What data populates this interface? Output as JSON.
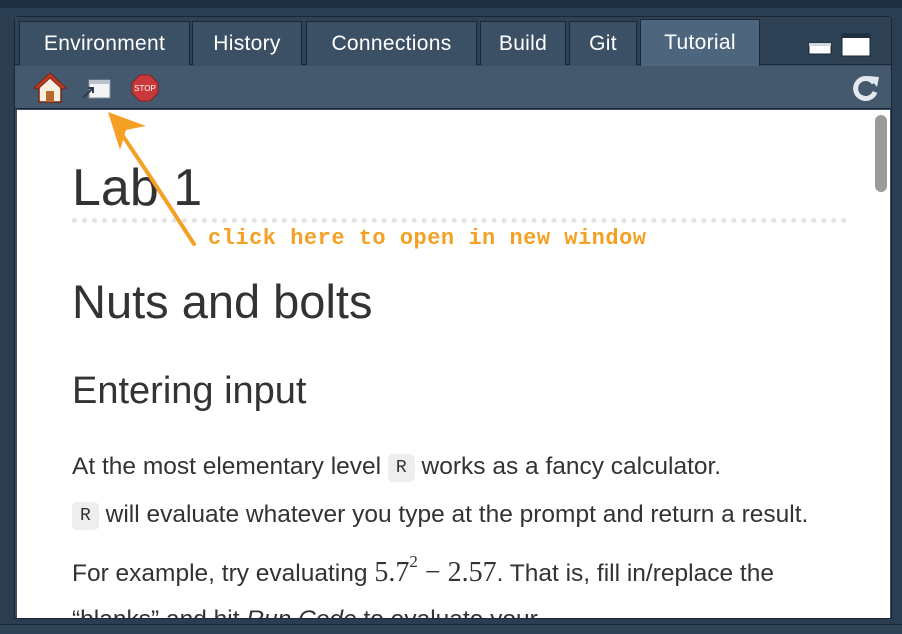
{
  "tabs": [
    {
      "label": "Environment",
      "active": false
    },
    {
      "label": "History",
      "active": false
    },
    {
      "label": "Connections",
      "active": false
    },
    {
      "label": "Build",
      "active": false
    },
    {
      "label": "Git",
      "active": false
    },
    {
      "label": "Tutorial",
      "active": true
    }
  ],
  "toolbar": {
    "home_icon": "home-icon",
    "popout_icon": "open-in-new-window-icon",
    "stop_icon": "stop-icon",
    "stop_label": "STOP",
    "refresh_icon": "refresh-icon"
  },
  "content": {
    "h1": "Lab 1",
    "h2": "Nuts and bolts",
    "h3": "Entering input",
    "p_1": "At the most elementary level ",
    "code_r": "R",
    "p_2": " works as a fancy calculator.",
    "p_3": " will evaluate whatever you type at the prompt and return a result. For example, try evaluating ",
    "math_base": "5.7",
    "math_exp": "2",
    "math_rest": " − 2.57",
    "p_4": ". That is, fill in/replace the “blanks” and hit ",
    "p_em": "Run Code",
    "p_5": " to evaluate your"
  },
  "annotation": {
    "text": "click here to open in new window",
    "color": "#f4a024"
  }
}
